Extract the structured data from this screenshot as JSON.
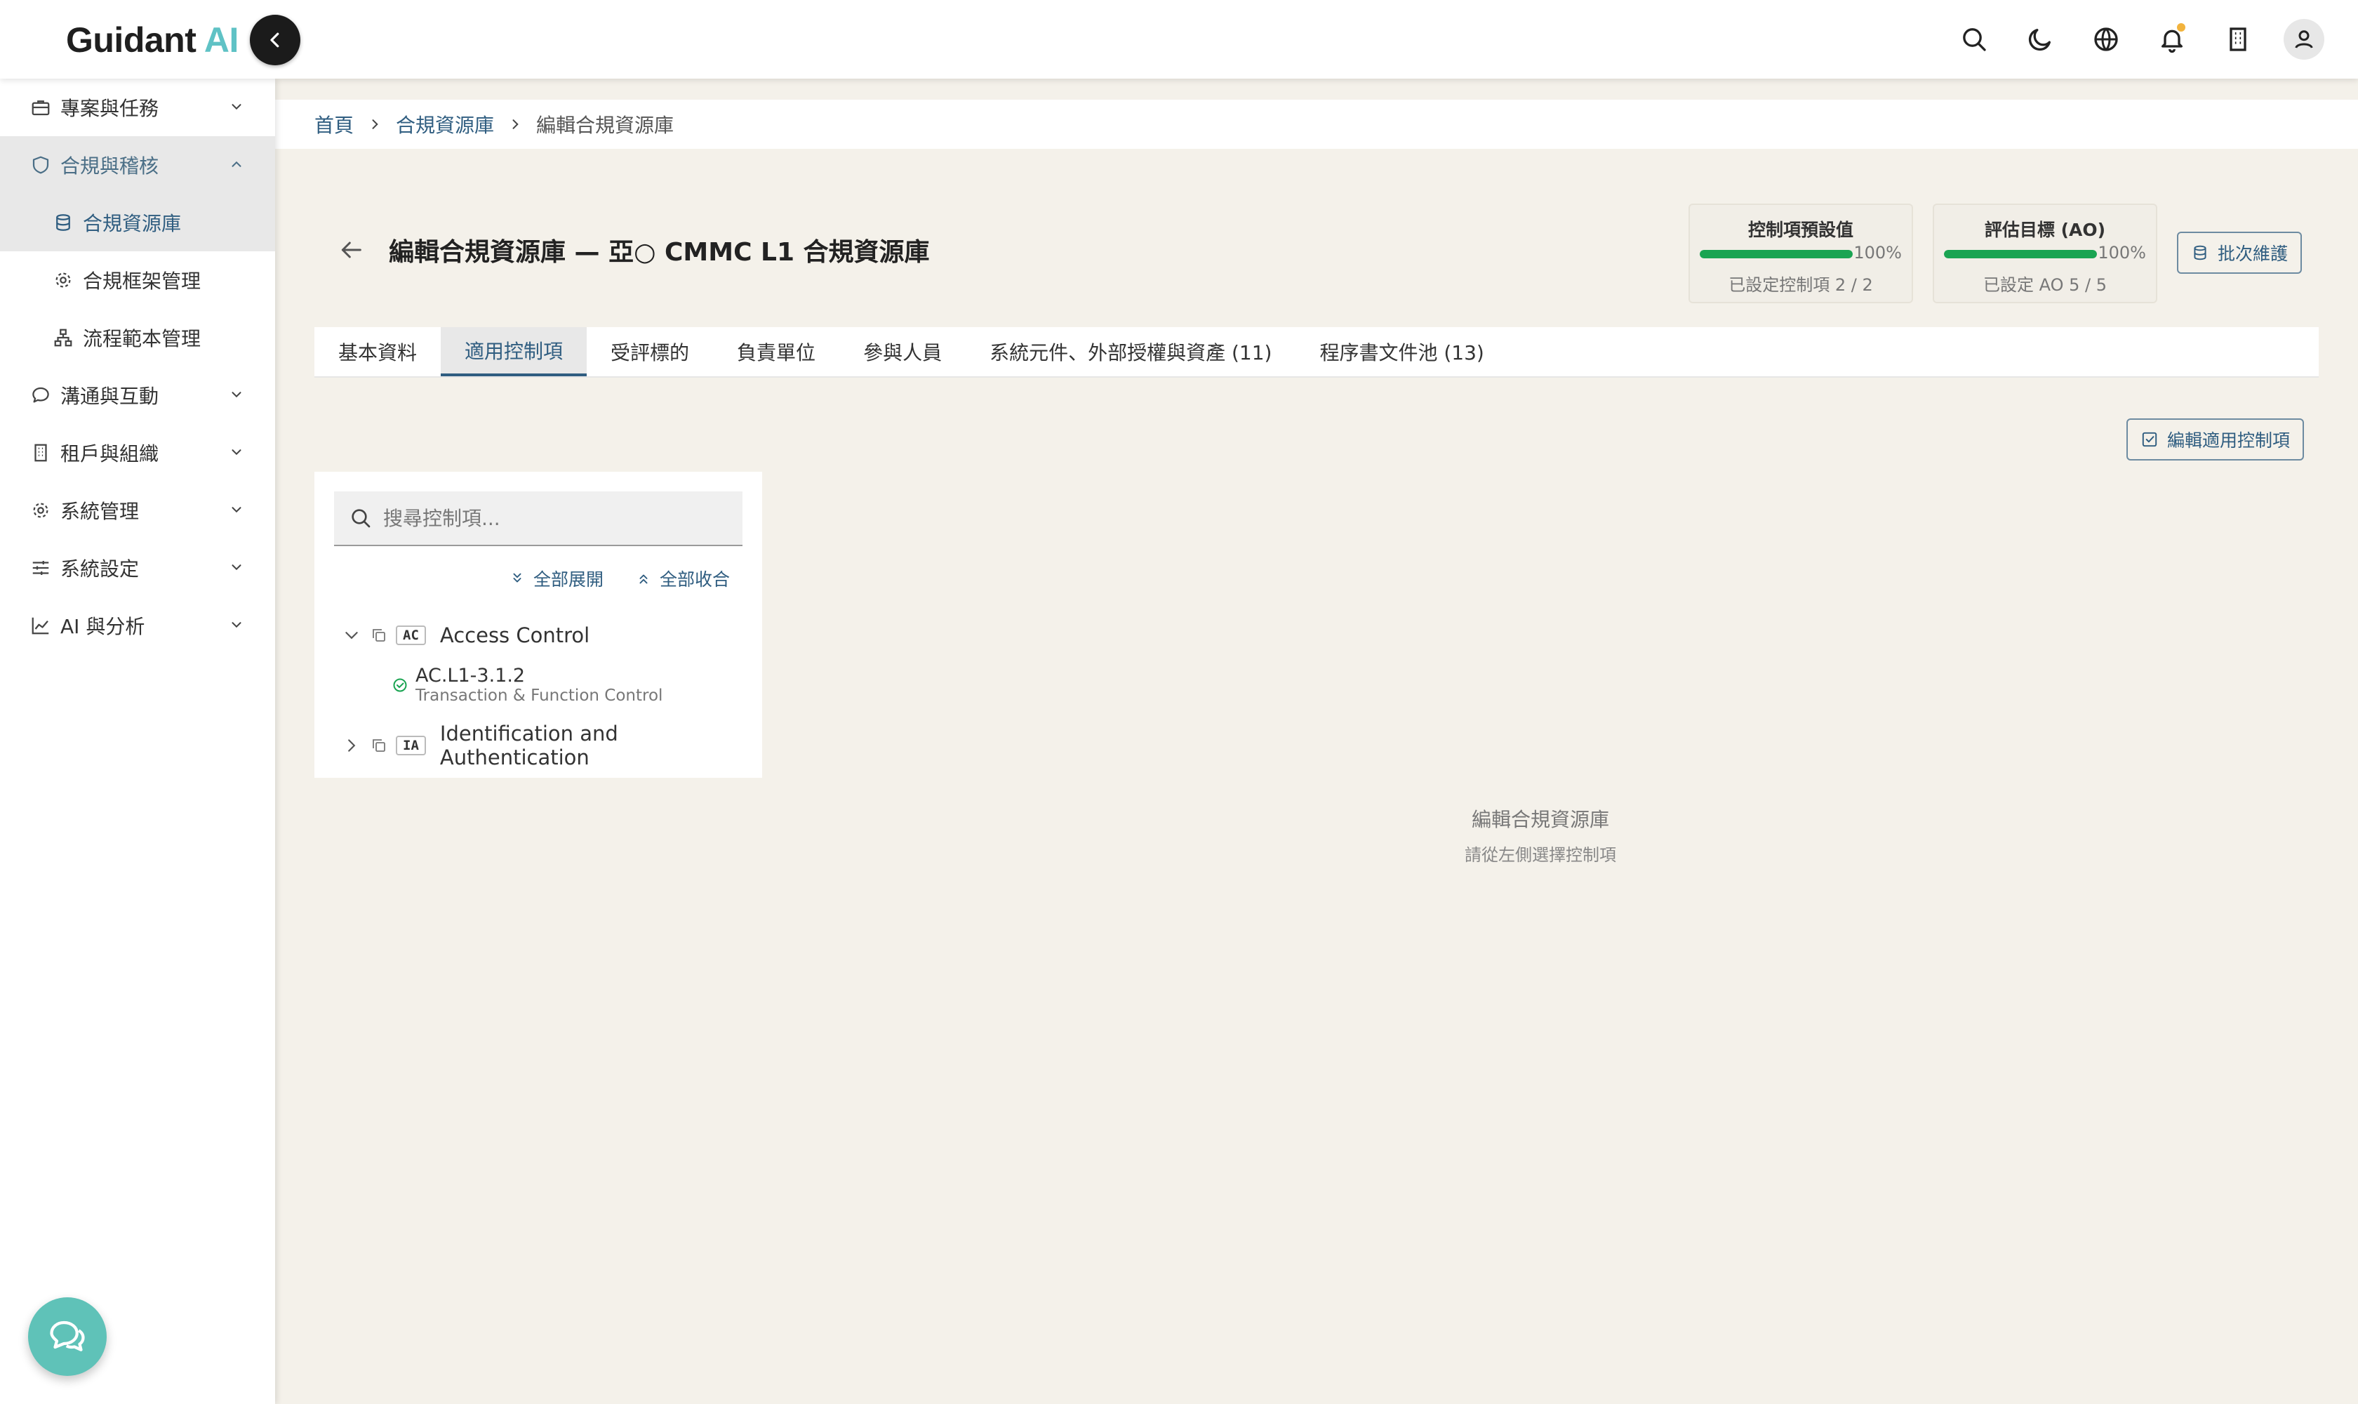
{
  "brand": {
    "name": "Guidant",
    "suffix": "AI"
  },
  "topbar": {
    "icons": [
      "search-icon",
      "moon-icon",
      "globe-icon",
      "bell-icon",
      "building-icon",
      "user-icon"
    ]
  },
  "colors": {
    "accent": "#2f5d80",
    "brand_ai": "#5fc2c5",
    "progress": "#1aa452",
    "notification": "#f2b33d",
    "background": "#f4f1ea"
  },
  "sidebar": {
    "items": [
      {
        "label": "專案與任務",
        "icon": "briefcase-icon"
      },
      {
        "label": "合規與稽核",
        "icon": "shield-icon",
        "expanded": true
      },
      {
        "label": "合規資源庫",
        "icon": "database-icon",
        "active": true
      },
      {
        "label": "合規框架管理",
        "icon": "gear-icon"
      },
      {
        "label": "流程範本管理",
        "icon": "flow-icon"
      },
      {
        "label": "溝通與互動",
        "icon": "chat-icon"
      },
      {
        "label": "租戶與組織",
        "icon": "building-icon"
      },
      {
        "label": "系統管理",
        "icon": "gear-icon"
      },
      {
        "label": "系統設定",
        "icon": "sliders-icon"
      },
      {
        "label": "AI 與分析",
        "icon": "chart-icon"
      }
    ]
  },
  "breadcrumb": {
    "home": "首頁",
    "parent": "合規資源庫",
    "current": "編輯合規資源庫"
  },
  "page": {
    "title": "編輯合規資源庫 — 亞○ CMMC L1 合規資源庫"
  },
  "stats": [
    {
      "title": "控制項預設值",
      "percent_label": "100%",
      "progress": 1.0,
      "subtitle": "已設定控制項 2 / 2"
    },
    {
      "title": "評估目標 (AO)",
      "percent_label": "100%",
      "progress": 1.0,
      "subtitle": "已設定 AO 5 / 5"
    }
  ],
  "actions": {
    "batch_label": "批次維護",
    "edit_controls_label": "編輯適用控制項"
  },
  "tabs": [
    {
      "label": "基本資料"
    },
    {
      "label": "適用控制項",
      "active": true
    },
    {
      "label": "受評標的"
    },
    {
      "label": "負責單位"
    },
    {
      "label": "參與人員"
    },
    {
      "label": "系統元件、外部授權與資產 (11)"
    },
    {
      "label": "程序書文件池 (13)"
    }
  ],
  "tree": {
    "search_placeholder": "搜尋控制項...",
    "expand_all": "全部展開",
    "collapse_all": "全部收合",
    "families": [
      {
        "code": "AC",
        "name": "Access Control",
        "expanded": true,
        "controls": [
          {
            "code": "AC.L1-3.1.2",
            "name": "Transaction & Function Control",
            "status": "complete"
          }
        ]
      },
      {
        "code": "IA",
        "name": "Identification and Authentication",
        "expanded": false
      }
    ]
  },
  "empty_state": {
    "title": "編輯合規資源庫",
    "subtitle": "請從左側選擇控制項"
  }
}
